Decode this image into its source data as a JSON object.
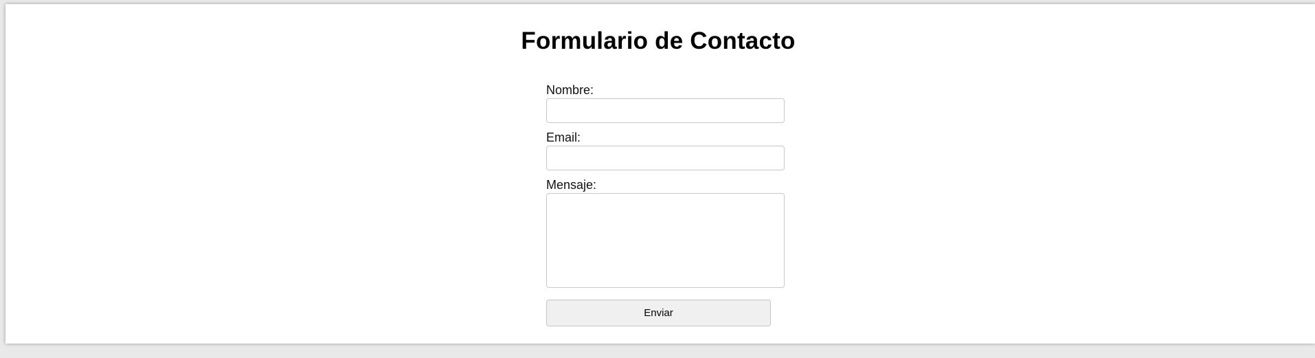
{
  "page": {
    "title": "Formulario de Contacto"
  },
  "form": {
    "name_label": "Nombre:",
    "name_value": "",
    "email_label": "Email:",
    "email_value": "",
    "message_label": "Mensaje:",
    "message_value": "",
    "submit_label": "Enviar"
  }
}
